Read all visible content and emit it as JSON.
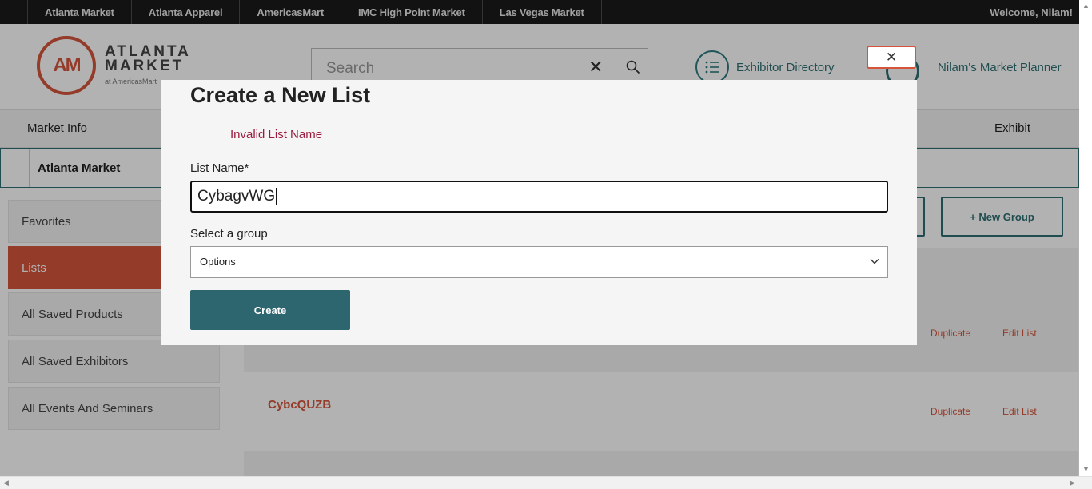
{
  "topbar": {
    "sites": [
      "Atlanta Market",
      "Atlanta Apparel",
      "AmericasMart",
      "IMC High Point Market",
      "Las Vegas Market"
    ],
    "welcome": "Welcome, Nilam!"
  },
  "header": {
    "logo_mark": "AM",
    "logo_line1": "ATLANTA",
    "logo_line2": "MARKET",
    "logo_sub": "at AmericasMart",
    "search_placeholder": "Search",
    "exhibitor_directory": "Exhibitor Directory",
    "planner": "Nilam's Market Planner"
  },
  "nav": {
    "market_info": "Market Info",
    "exhibit": "Exhibit",
    "sub_label": "Atlanta Market"
  },
  "sidebar": {
    "items": [
      {
        "label": "Favorites",
        "active": false
      },
      {
        "label": "Lists",
        "active": true
      },
      {
        "label": "All Saved Products",
        "active": false
      },
      {
        "label": "All Saved Exhibitors",
        "active": false
      },
      {
        "label": "All Events And Seminars",
        "active": false
      }
    ]
  },
  "main": {
    "new_group": "+  New Group",
    "rows": [
      {
        "name": "",
        "duplicate": "Duplicate",
        "edit": "Edit List"
      },
      {
        "name": "CybcQUZB",
        "duplicate": "Duplicate",
        "edit": "Edit List"
      }
    ]
  },
  "modal": {
    "title": "Create a New List",
    "error": "Invalid List Name",
    "list_name_label": "List Name*",
    "list_name_value": "CybagvWG",
    "group_label": "Select a group",
    "group_value": "Options",
    "create_label": "Create",
    "close_glyph": "✕"
  },
  "colors": {
    "accent": "#d4553c",
    "teal": "#2e6f73",
    "error": "#9b1b3c"
  }
}
